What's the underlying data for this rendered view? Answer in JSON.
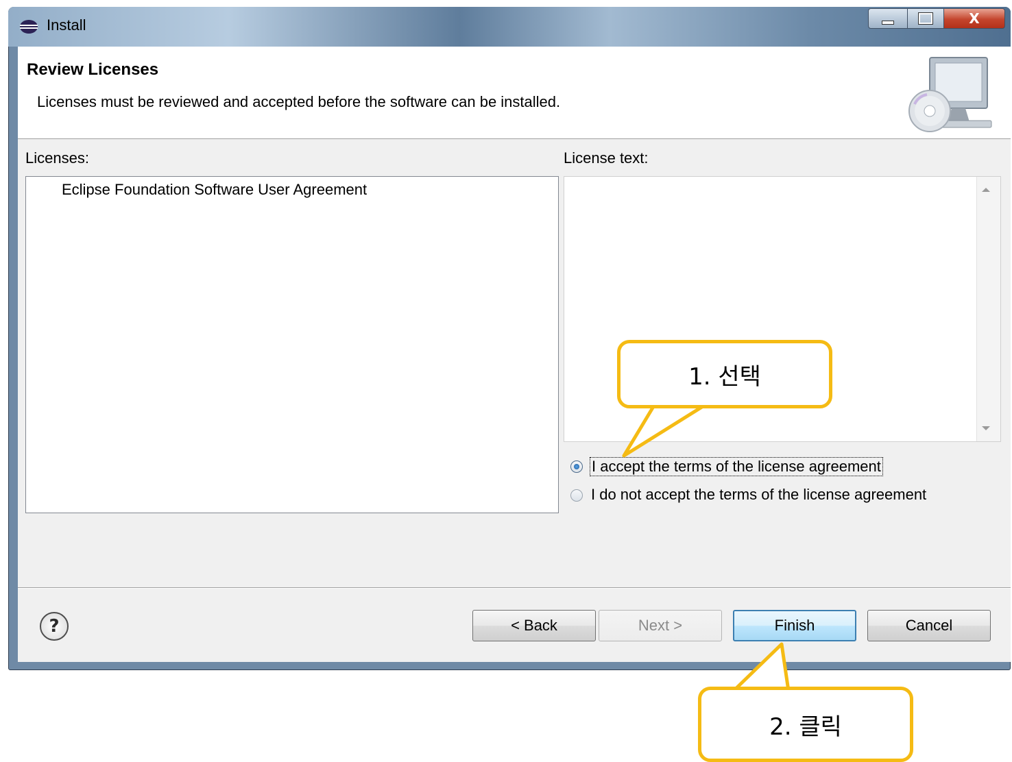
{
  "window": {
    "title": "Install",
    "icon": "eclipse-icon",
    "controls": [
      "minimize-icon",
      "maximize-icon",
      "close-icon"
    ],
    "close_glyph": "X"
  },
  "banner": {
    "title": "Review Licenses",
    "description": "Licenses must be reviewed and accepted before the software can be installed.",
    "image": "install-monitor-cd-icon"
  },
  "licenses": {
    "label": "Licenses:",
    "items": [
      "Eclipse Foundation Software User Agreement"
    ]
  },
  "license_text": {
    "label": "License text:",
    "content": ""
  },
  "options": {
    "accept_label": "I accept the terms of the license agreement",
    "decline_label": "I do not accept the terms of the license agreement",
    "selected": "accept"
  },
  "buttons": {
    "help_glyph": "?",
    "back": "< Back",
    "next": "Next >",
    "finish": "Finish",
    "cancel": "Cancel",
    "next_enabled": false
  },
  "annotations": {
    "callout_1": "1. 선택",
    "callout_2": "2. 클릭",
    "color": "#f5bb14"
  }
}
